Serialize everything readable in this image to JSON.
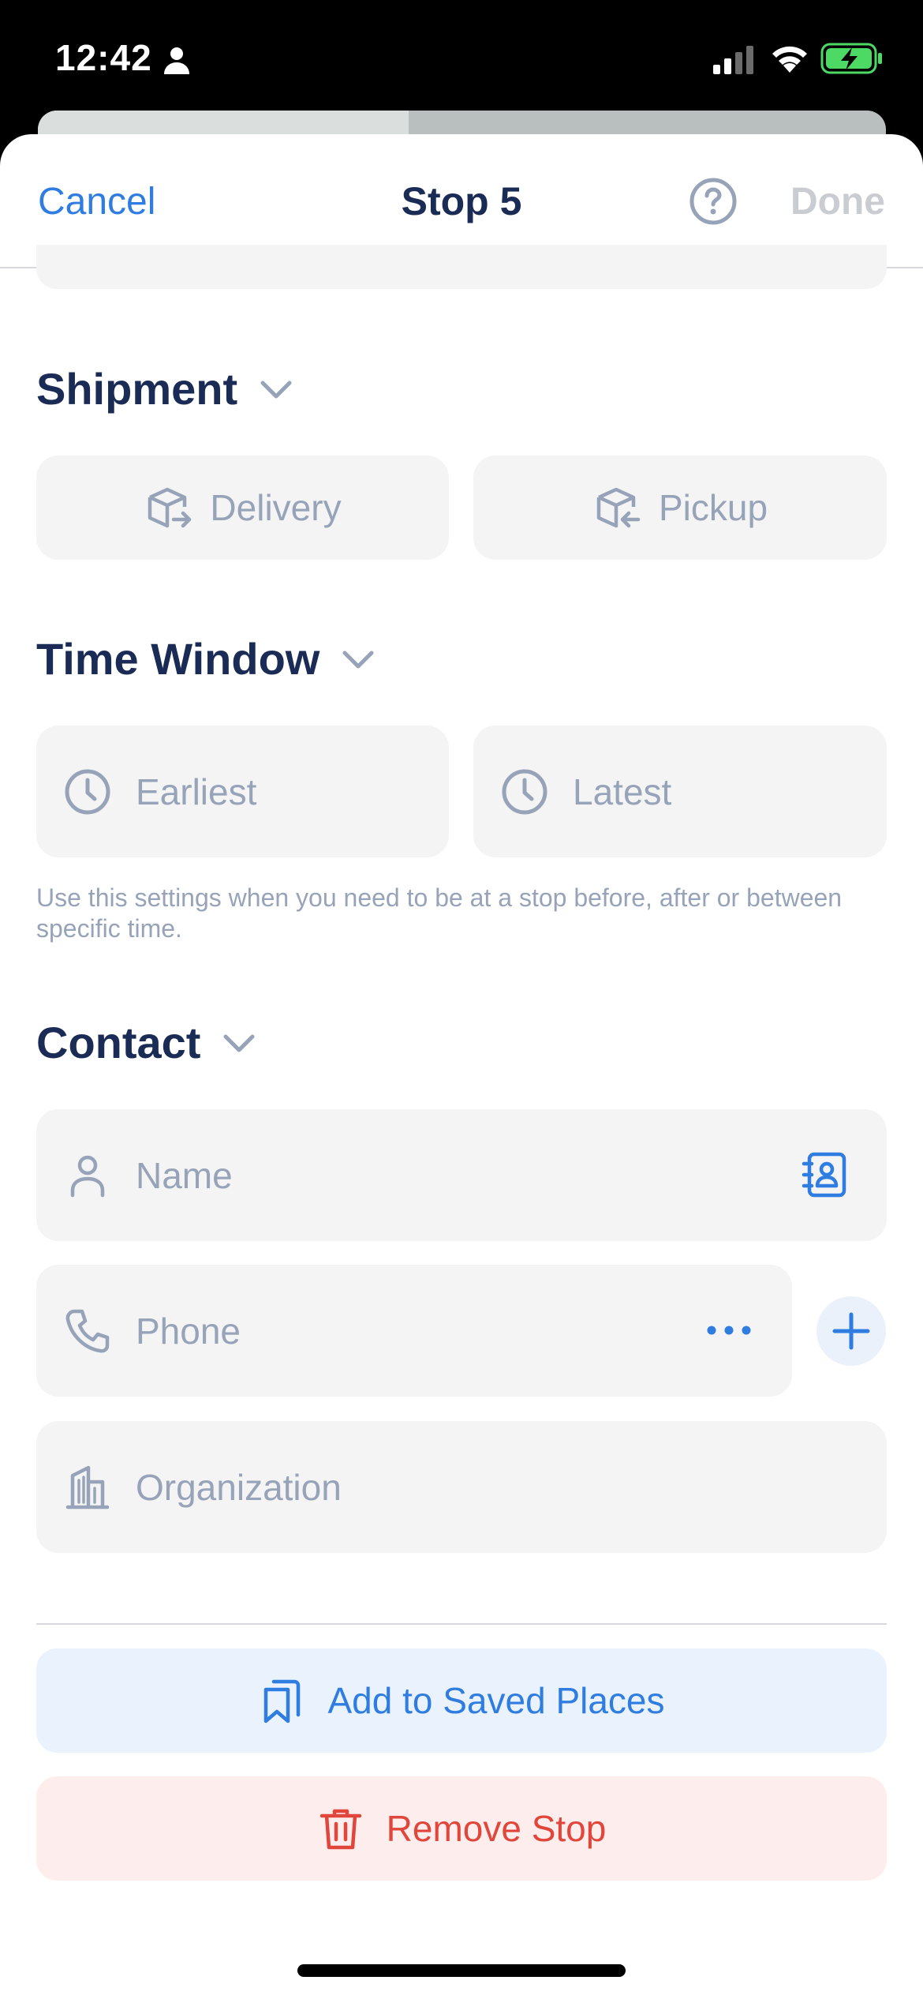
{
  "status_bar": {
    "time": "12:42"
  },
  "nav": {
    "cancel": "Cancel",
    "title": "Stop 5",
    "done": "Done"
  },
  "shipment": {
    "title": "Shipment",
    "delivery": "Delivery",
    "pickup": "Pickup"
  },
  "time_window": {
    "title": "Time Window",
    "earliest": "Earliest",
    "latest": "Latest",
    "hint": "Use this settings when you need to be at a stop before, after or between specific time."
  },
  "contact": {
    "title": "Contact",
    "name_placeholder": "Name",
    "phone_placeholder": "Phone",
    "organization_placeholder": "Organization"
  },
  "actions": {
    "save": "Add to Saved Places",
    "remove": "Remove Stop"
  },
  "colors": {
    "accent": "#2f7de1",
    "title": "#1a2b55",
    "muted": "#97a3b8",
    "danger": "#e0463b"
  }
}
